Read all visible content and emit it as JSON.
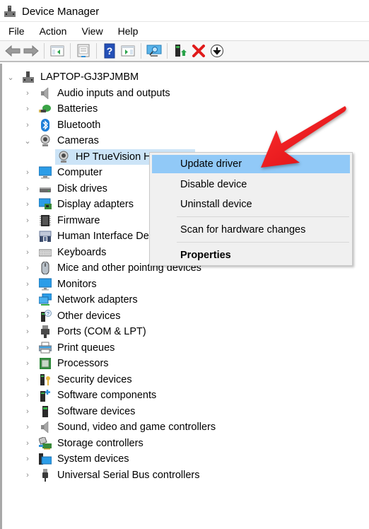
{
  "window": {
    "title": "Device Manager",
    "icon": "device-manager-icon"
  },
  "menubar": {
    "items": [
      "File",
      "Action",
      "View",
      "Help"
    ]
  },
  "toolbar": {
    "buttons": [
      {
        "name": "back-button",
        "icon": "arrow-left-icon"
      },
      {
        "name": "forward-button",
        "icon": "arrow-right-icon"
      },
      {
        "name": "show-hide-console-tree-button",
        "icon": "console-tree-icon"
      },
      {
        "name": "properties-button",
        "icon": "properties-icon"
      },
      {
        "name": "help-button",
        "icon": "help-icon"
      },
      {
        "name": "show-action-pane-button",
        "icon": "action-pane-icon"
      },
      {
        "name": "scan-hardware-button",
        "icon": "monitor-scan-icon"
      },
      {
        "name": "update-driver-button",
        "icon": "update-driver-icon"
      },
      {
        "name": "uninstall-device-button",
        "icon": "red-x-icon"
      },
      {
        "name": "disable-device-button",
        "icon": "down-arrow-circle-icon"
      }
    ]
  },
  "tree": {
    "root": {
      "label": "LAPTOP-GJ3PJMBM",
      "expanded": true,
      "icon": "computer-root-icon"
    },
    "categories": [
      {
        "label": "Audio inputs and outputs",
        "icon": "speaker-icon",
        "expanded": false
      },
      {
        "label": "Batteries",
        "icon": "battery-icon",
        "expanded": false
      },
      {
        "label": "Bluetooth",
        "icon": "bluetooth-icon",
        "expanded": false
      },
      {
        "label": "Cameras",
        "icon": "camera-icon",
        "expanded": true,
        "children": [
          {
            "label": "HP TrueVision HD",
            "icon": "webcam-icon",
            "selected": true
          }
        ]
      },
      {
        "label": "Computer",
        "icon": "computer-icon",
        "expanded": false
      },
      {
        "label": "Disk drives",
        "icon": "disk-drive-icon",
        "expanded": false
      },
      {
        "label": "Display adapters",
        "icon": "display-adapter-icon",
        "expanded": false
      },
      {
        "label": "Firmware",
        "icon": "chip-icon",
        "expanded": false
      },
      {
        "label": "Human Interface Devices",
        "icon": "hid-icon",
        "expanded": false
      },
      {
        "label": "Keyboards",
        "icon": "keyboard-icon",
        "expanded": false
      },
      {
        "label": "Mice and other pointing devices",
        "icon": "mouse-icon",
        "expanded": false
      },
      {
        "label": "Monitors",
        "icon": "monitor-icon",
        "expanded": false
      },
      {
        "label": "Network adapters",
        "icon": "network-icon",
        "expanded": false
      },
      {
        "label": "Other devices",
        "icon": "unknown-device-icon",
        "expanded": false
      },
      {
        "label": "Ports (COM & LPT)",
        "icon": "port-icon",
        "expanded": false
      },
      {
        "label": "Print queues",
        "icon": "printer-icon",
        "expanded": false
      },
      {
        "label": "Processors",
        "icon": "processor-icon",
        "expanded": false
      },
      {
        "label": "Security devices",
        "icon": "security-key-icon",
        "expanded": false
      },
      {
        "label": "Software components",
        "icon": "software-component-icon",
        "expanded": false
      },
      {
        "label": "Software devices",
        "icon": "software-device-icon",
        "expanded": false
      },
      {
        "label": "Sound, video and game controllers",
        "icon": "speaker-icon",
        "expanded": false
      },
      {
        "label": "Storage controllers",
        "icon": "storage-controller-icon",
        "expanded": false
      },
      {
        "label": "System devices",
        "icon": "system-device-icon",
        "expanded": false
      },
      {
        "label": "Universal Serial Bus controllers",
        "icon": "usb-icon",
        "expanded": false
      }
    ]
  },
  "context_menu": {
    "items": [
      {
        "label": "Update driver",
        "highlighted": true,
        "bold": false
      },
      {
        "label": "Disable device",
        "highlighted": false,
        "bold": false
      },
      {
        "label": "Uninstall device",
        "highlighted": false,
        "bold": false
      },
      {
        "label": "Scan for hardware changes",
        "highlighted": false,
        "bold": false
      },
      {
        "label": "Properties",
        "highlighted": false,
        "bold": true
      }
    ]
  },
  "annotation": {
    "type": "red-arrow",
    "points_to": "Update driver",
    "color": "#e8141a"
  },
  "colors": {
    "selection": "#cce4f7",
    "menu_highlight": "#91c9f7",
    "menu_bg": "#f0f0f0",
    "accent_blue": "#1e7fd8"
  }
}
